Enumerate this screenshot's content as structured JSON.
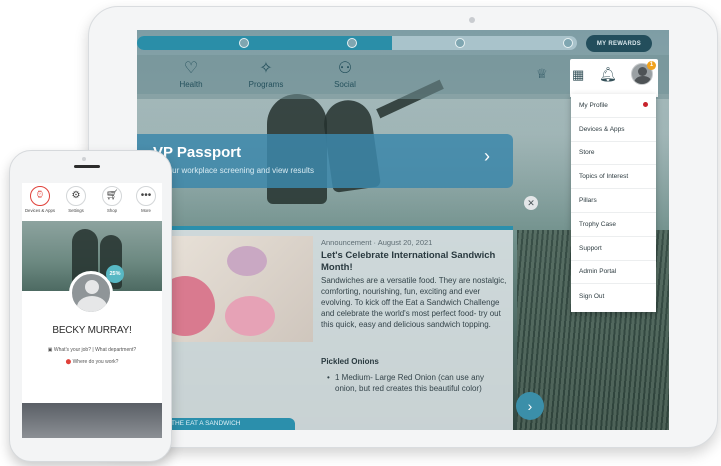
{
  "tablet": {
    "rewards_label": "MY REWARDS",
    "progress": 0.58,
    "nav": [
      {
        "label": "Health",
        "icon": "heart-icon"
      },
      {
        "label": "Programs",
        "icon": "programs-icon"
      },
      {
        "label": "Social",
        "icon": "social-icon"
      }
    ],
    "notification_count": "1",
    "menu": [
      "My Profile",
      "Devices & Apps",
      "Store",
      "Topics of Interest",
      "Pillars",
      "Trophy Case",
      "Support",
      "Admin Portal",
      "Sign Out"
    ],
    "passport": {
      "title": "VP Passport",
      "subtitle": "ke your workplace screening and view results"
    },
    "announcement": {
      "meta": "Announcement · August 20, 2021",
      "title": "Let's Celebrate International Sandwich Month!",
      "body": "Sandwiches are a versatile food. They are nostalgic, comforting, nourishing, fun, exciting and ever evolving. To kick off the Eat a Sandwich Challenge and celebrate the world's most perfect food- try out this quick, easy and delicious sandwich topping.",
      "subheading": "Pickled Onions",
      "list_item": "1 Medium- Large Red Onion (can use any onion, but red creates this beautiful color)",
      "cta": "THE EAT A SANDWICH"
    }
  },
  "phone": {
    "icons": [
      {
        "label": "Devices & Apps",
        "icon": "watch-icon"
      },
      {
        "label": "Settings",
        "icon": "gear-icon"
      },
      {
        "label": "Shop",
        "icon": "cart-icon"
      },
      {
        "label": "More",
        "icon": "more-icon"
      }
    ],
    "badge": "25%",
    "name": "BECKY MURRAY!",
    "job_line": "What's your job? | What department?",
    "where_line": "Where do you work?"
  },
  "colors": {
    "accent": "#2b8fac",
    "rewards_bg": "#234e5c",
    "notification": "#f0a21d",
    "active_icon": "#e0413a"
  }
}
